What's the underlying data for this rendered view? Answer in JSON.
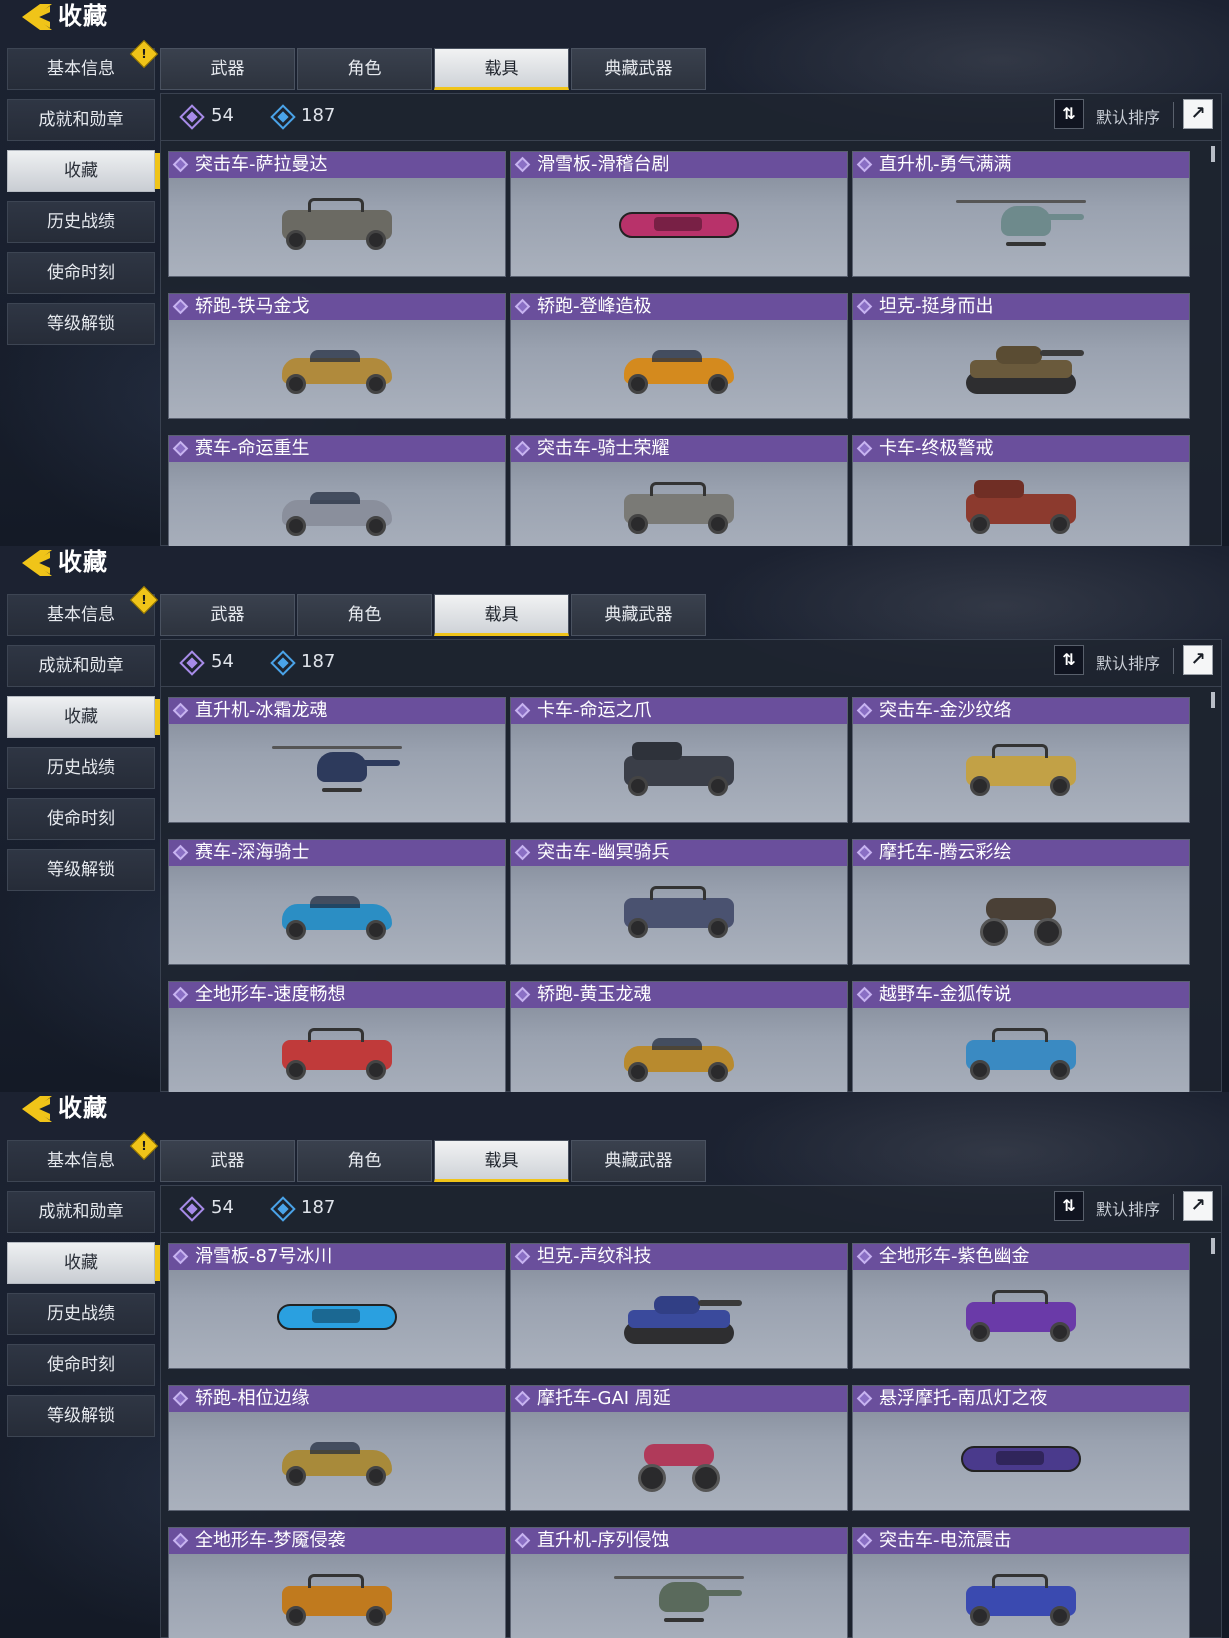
{
  "screens": [
    {
      "title": "收藏",
      "sidebar": [
        "基本信息",
        "成就和勋章",
        "收藏",
        "历史战绩",
        "使命时刻",
        "等级解锁"
      ],
      "sidebar_active": 2,
      "tabs": [
        "武器",
        "角色",
        "载具",
        "典藏武器"
      ],
      "tab_active": 2,
      "stats": {
        "purple_count": "54",
        "blue_count": "187"
      },
      "sort_label": "默认排序",
      "items": [
        {
          "name": "突击车-萨拉曼达",
          "type": "buggy",
          "color": "#6b6a63"
        },
        {
          "name": "滑雪板-滑稽台剧",
          "type": "board",
          "color": "#b8326a"
        },
        {
          "name": "直升机-勇气满满",
          "type": "heli",
          "color": "#6e8a8c"
        },
        {
          "name": "轿跑-铁马金戈",
          "type": "car",
          "color": "#b08a3c"
        },
        {
          "name": "轿跑-登峰造极",
          "type": "car",
          "color": "#d48a1e"
        },
        {
          "name": "坦克-挺身而出",
          "type": "tank",
          "color": "#6a5a3c"
        },
        {
          "name": "赛车-命运重生",
          "type": "car",
          "color": "#8a8f9c"
        },
        {
          "name": "突击车-骑士荣耀",
          "type": "buggy",
          "color": "#7a7a76"
        },
        {
          "name": "卡车-终极警戒",
          "type": "truck",
          "color": "#8c3a2e"
        }
      ]
    },
    {
      "title": "收藏",
      "sidebar": [
        "基本信息",
        "成就和勋章",
        "收藏",
        "历史战绩",
        "使命时刻",
        "等级解锁"
      ],
      "sidebar_active": 2,
      "tabs": [
        "武器",
        "角色",
        "载具",
        "典藏武器"
      ],
      "tab_active": 2,
      "stats": {
        "purple_count": "54",
        "blue_count": "187"
      },
      "sort_label": "默认排序",
      "items": [
        {
          "name": "直升机-冰霜龙魂",
          "type": "heli",
          "color": "#2d3a5c"
        },
        {
          "name": "卡车-命运之爪",
          "type": "truck",
          "color": "#3a3e48"
        },
        {
          "name": "突击车-金沙纹络",
          "type": "buggy",
          "color": "#c2a146"
        },
        {
          "name": "赛车-深海骑士",
          "type": "car",
          "color": "#2b8ec4"
        },
        {
          "name": "突击车-幽冥骑兵",
          "type": "buggy",
          "color": "#4a5270"
        },
        {
          "name": "摩托车-腾云彩绘",
          "type": "moto",
          "color": "#4a4036"
        },
        {
          "name": "全地形车-速度畅想",
          "type": "atv",
          "color": "#c03a3a"
        },
        {
          "name": "轿跑-黄玉龙魂",
          "type": "car",
          "color": "#b88a2e"
        },
        {
          "name": "越野车-金狐传说",
          "type": "buggy",
          "color": "#3a8ac2"
        }
      ]
    },
    {
      "title": "收藏",
      "sidebar": [
        "基本信息",
        "成就和勋章",
        "收藏",
        "历史战绩",
        "使命时刻",
        "等级解锁"
      ],
      "sidebar_active": 2,
      "tabs": [
        "武器",
        "角色",
        "载具",
        "典藏武器"
      ],
      "tab_active": 2,
      "stats": {
        "purple_count": "54",
        "blue_count": "187"
      },
      "sort_label": "默认排序",
      "items": [
        {
          "name": "滑雪板-87号冰川",
          "type": "board",
          "color": "#2aa0e0"
        },
        {
          "name": "坦克-声纹科技",
          "type": "tank",
          "color": "#3a4a9c"
        },
        {
          "name": "全地形车-紫色幽金",
          "type": "atv",
          "color": "#6a3aa8"
        },
        {
          "name": "轿跑-相位边缘",
          "type": "car",
          "color": "#a88a3a"
        },
        {
          "name": "摩托车-GAI 周延",
          "type": "moto",
          "color": "#b03a5a"
        },
        {
          "name": "悬浮摩托-南瓜灯之夜",
          "type": "board",
          "color": "#4a3a8c"
        },
        {
          "name": "全地形车-梦魇侵袭",
          "type": "atv",
          "color": "#c07a1e"
        },
        {
          "name": "直升机-序列侵蚀",
          "type": "heli",
          "color": "#5a6a5c"
        },
        {
          "name": "突击车-电流震击",
          "type": "buggy",
          "color": "#3a4ab0"
        }
      ]
    }
  ],
  "colors": {
    "accent": "#f0c419",
    "card_title_bg": "#6a4f9c",
    "gem_purple": "#a78be8",
    "gem_blue": "#4aa3e8"
  },
  "icons": {
    "back": "back-chevron-icon",
    "warn": "warning-icon",
    "sort": "sort-arrows-icon",
    "share": "share-icon",
    "gem": "diamond-gem-icon"
  }
}
